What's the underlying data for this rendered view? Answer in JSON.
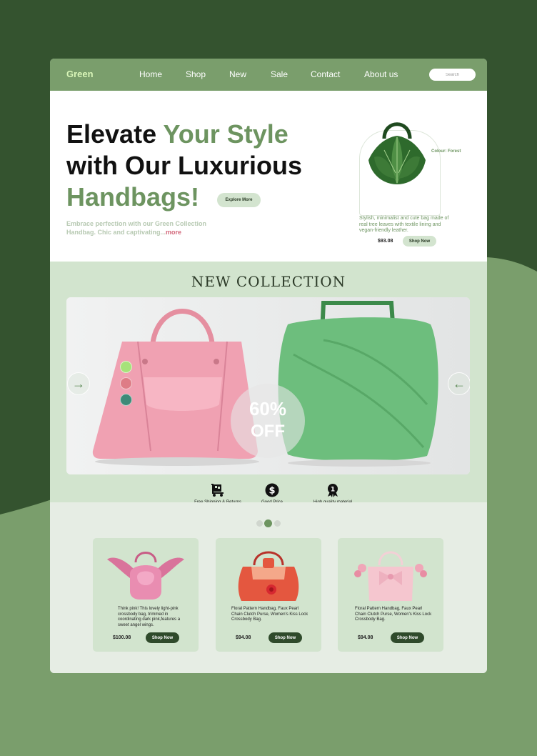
{
  "colors": {
    "dark_green": "#34532f",
    "sage": "#7a9e6c",
    "light_green": "#d2e4ce",
    "accent_pink": "#d2677a"
  },
  "nav": {
    "logo": "Green",
    "items": [
      "Home",
      "Shop",
      "New",
      "Sale",
      "Contact",
      "About us"
    ],
    "search_placeholder": "Search"
  },
  "hero": {
    "title_part1": "Elevate",
    "title_part2": "Your Style",
    "title_part3": "with Our Luxurious",
    "title_part4": "Handbags!",
    "explore_label": "Explore More",
    "description": "Embrace perfection with our Green Collection Handbag. Chic and captivating...",
    "more_label": "more",
    "product": {
      "colour": "Colour: Forest",
      "description": "Stylish, minimalist and cute bag made of real tree leaves with textile lining and vegan-friendly leather.",
      "price": "$93.08",
      "shop_label": "Shop Now"
    }
  },
  "collection": {
    "title": "NEW COLLECTION",
    "discount_value": "60%",
    "discount_label": "OFF",
    "swatches": [
      "#a6e27a",
      "#de7c86",
      "#3d8a78"
    ],
    "features": [
      {
        "label": "Free Shipping & Returns",
        "icon": "shipping-cart-icon"
      },
      {
        "label": "Good Price",
        "icon": "dollar-coin-icon"
      },
      {
        "label": "High quality material",
        "icon": "quality-badge-icon"
      }
    ]
  },
  "products": [
    {
      "description": "Think pink! This lovely light-pink crossbody bag, trimmed in coordinating dark pink,features a sweet angel wings.",
      "price": "$100.08",
      "shop_label": "Shop Now"
    },
    {
      "description": "Floral Pattern Handbag, Faux Pearl Chain Clutch Purse, Women's Kiss Lock Crossbody Bag.",
      "price": "$94.08",
      "shop_label": "Shop Now"
    },
    {
      "description": "Floral Pattern Handbag, Faux Pearl Chain Clutch Purse, Women's Kiss Lock Crossbody Bag.",
      "price": "$94.08",
      "shop_label": "Shop Now"
    }
  ]
}
